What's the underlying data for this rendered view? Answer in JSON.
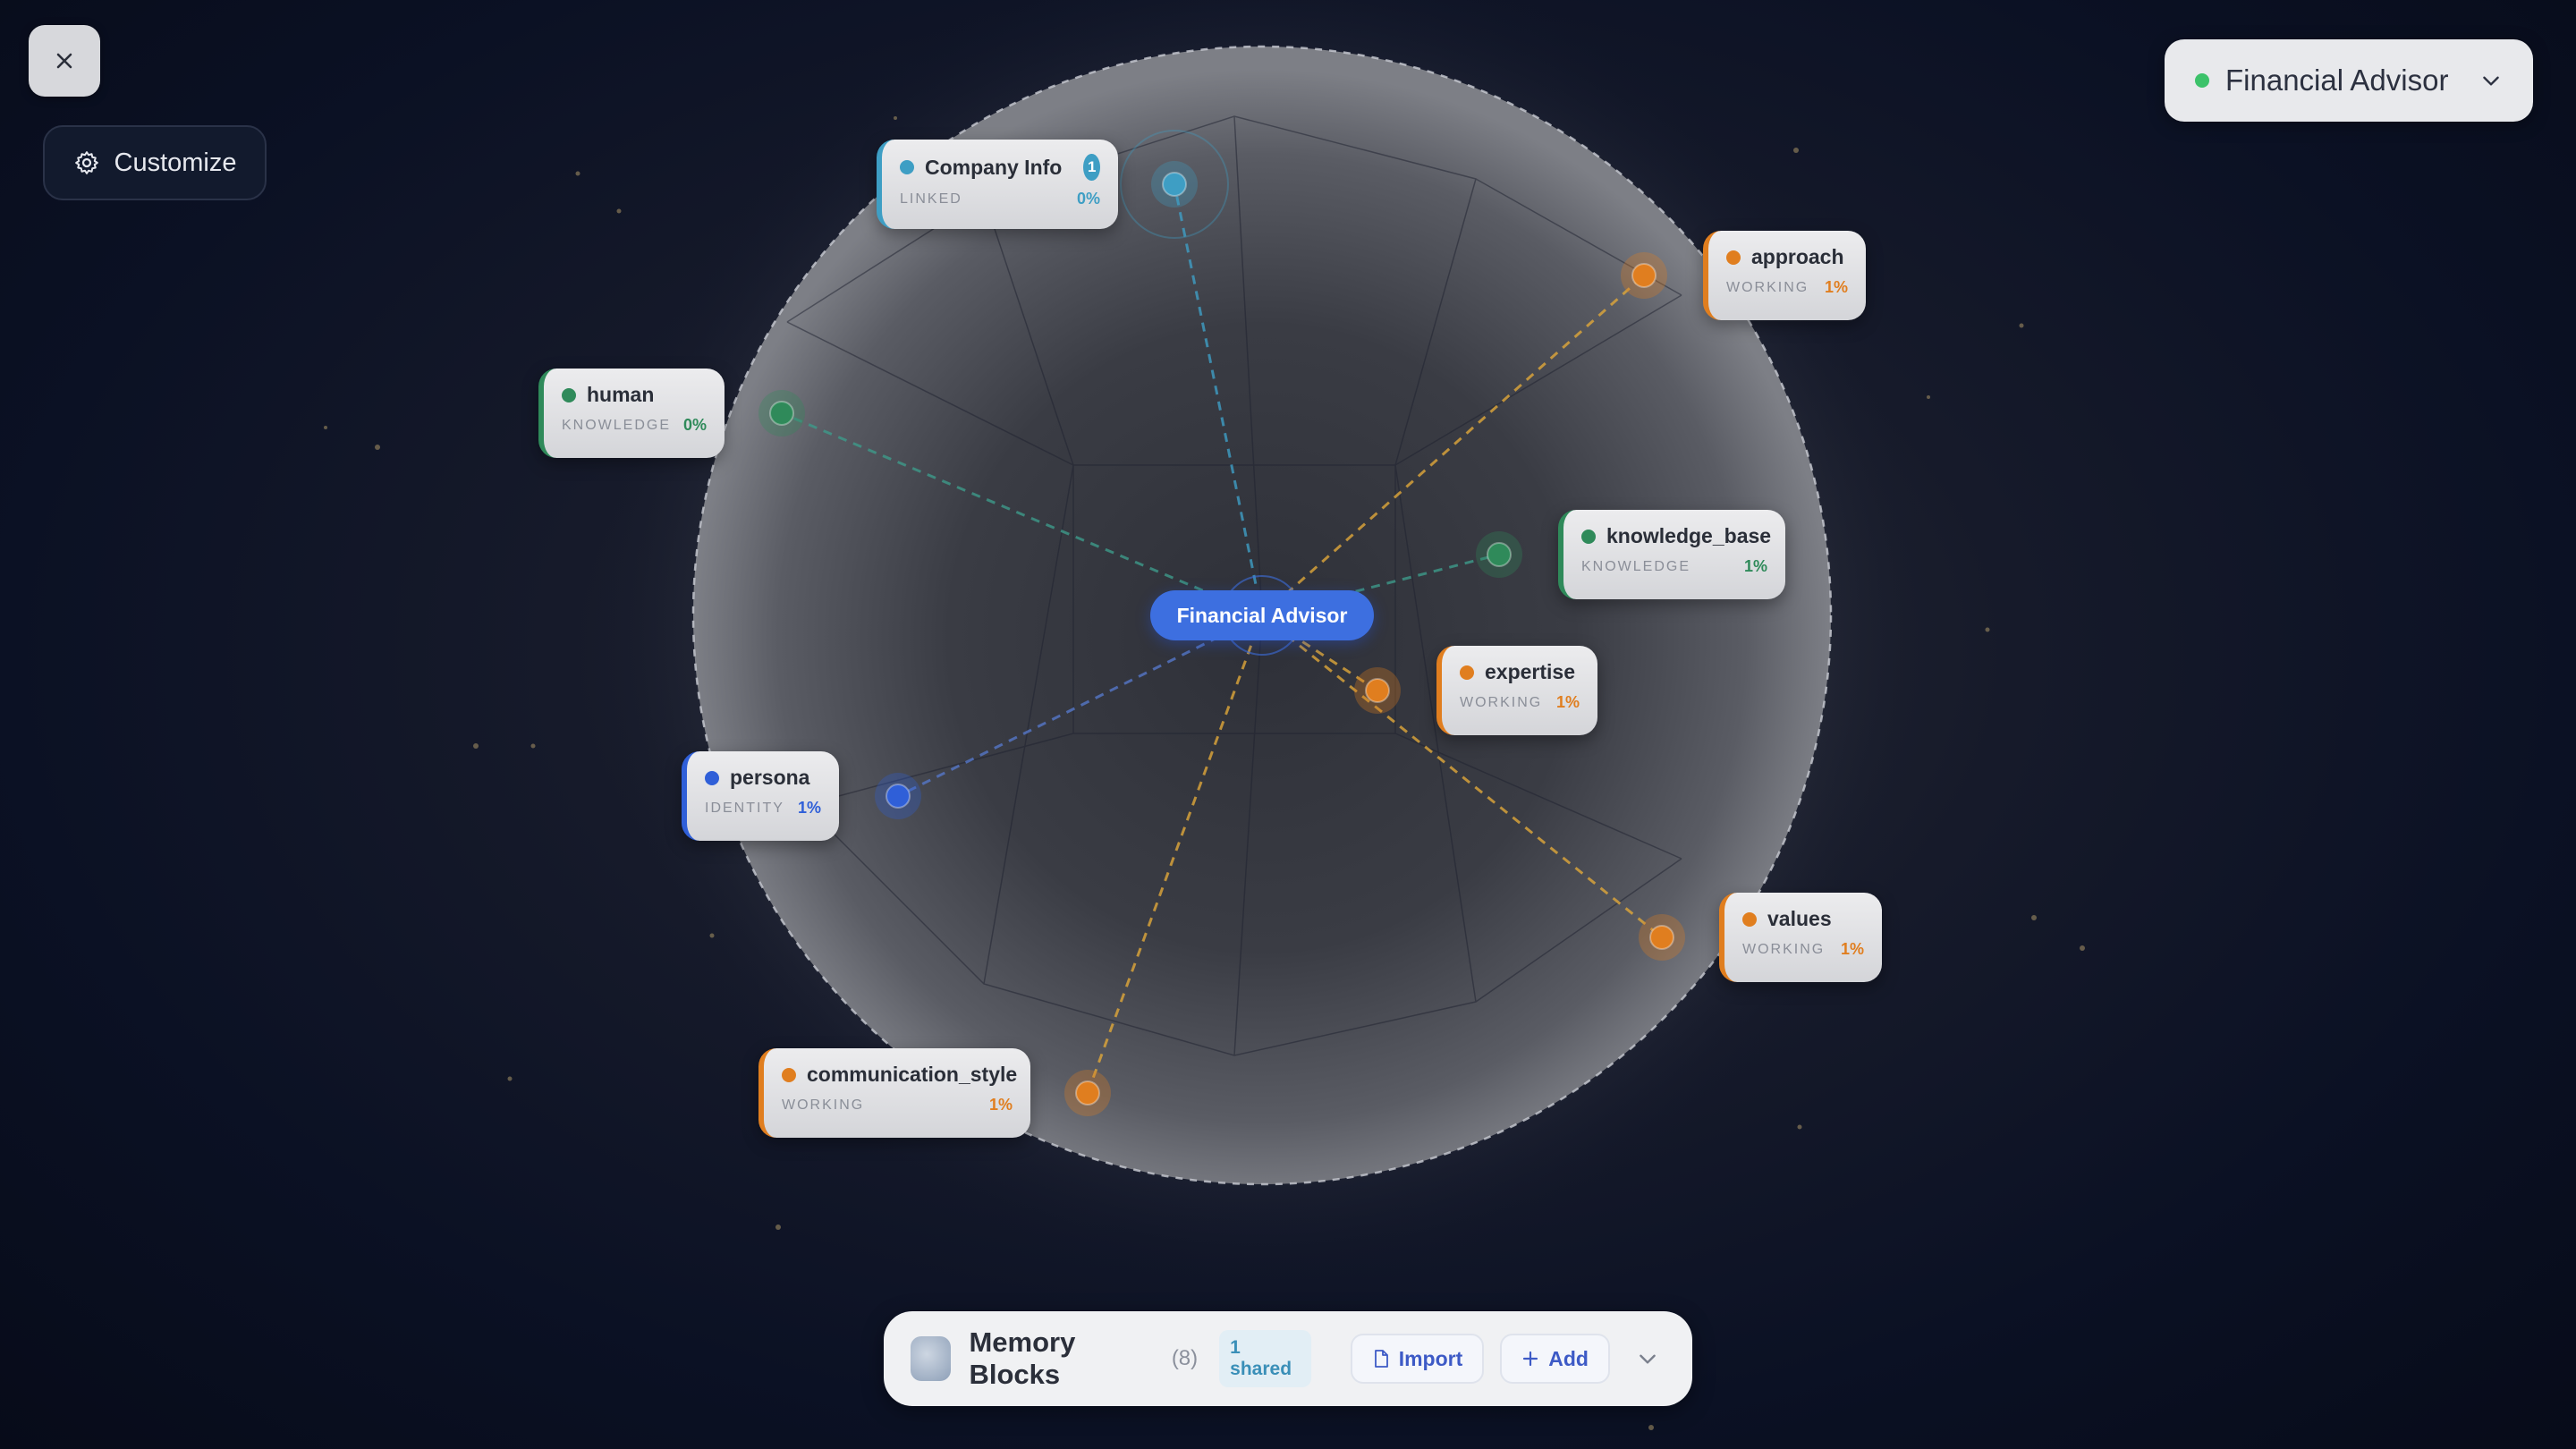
{
  "header": {
    "close_label": "",
    "customize_label": "Customize",
    "agent_name": "Financial Advisor",
    "agent_status_color": "#3cc26a"
  },
  "center": {
    "label": "Financial Advisor"
  },
  "colors": {
    "linked": "#3e9ec4",
    "knowledge": "#2f8a5a",
    "working": "#e07e1f",
    "identity": "#2f5fd8",
    "center": "#3d6fe0"
  },
  "blocks": [
    {
      "id": "company-info",
      "label": "Company Info",
      "type": "LINKED",
      "percent": "0%",
      "color": "#3e9ec4",
      "badge": "1"
    },
    {
      "id": "approach",
      "label": "approach",
      "type": "WORKING",
      "percent": "1%",
      "color": "#e07e1f"
    },
    {
      "id": "human",
      "label": "human",
      "type": "KNOWLEDGE",
      "percent": "0%",
      "color": "#2f8a5a"
    },
    {
      "id": "knowledge-base",
      "label": "knowledge_base",
      "type": "KNOWLEDGE",
      "percent": "1%",
      "color": "#2f8a5a"
    },
    {
      "id": "expertise",
      "label": "expertise",
      "type": "WORKING",
      "percent": "1%",
      "color": "#e07e1f"
    },
    {
      "id": "persona",
      "label": "persona",
      "type": "IDENTITY",
      "percent": "1%",
      "color": "#2f5fd8"
    },
    {
      "id": "values",
      "label": "values",
      "type": "WORKING",
      "percent": "1%",
      "color": "#e07e1f"
    },
    {
      "id": "communication-style",
      "label": "communication_style",
      "type": "WORKING",
      "percent": "1%",
      "color": "#e07e1f"
    }
  ],
  "toolbar": {
    "title": "Memory Blocks",
    "count": "(8)",
    "shared": "1 shared",
    "import_label": "Import",
    "add_label": "Add"
  },
  "icons": {
    "close": "close-icon",
    "customize": "gear-icon",
    "agent_dropdown": "chevron-down-icon",
    "toolbar_logo": "brain-icon",
    "import": "file-icon",
    "add": "plus-icon",
    "expand": "chevron-down-icon"
  }
}
